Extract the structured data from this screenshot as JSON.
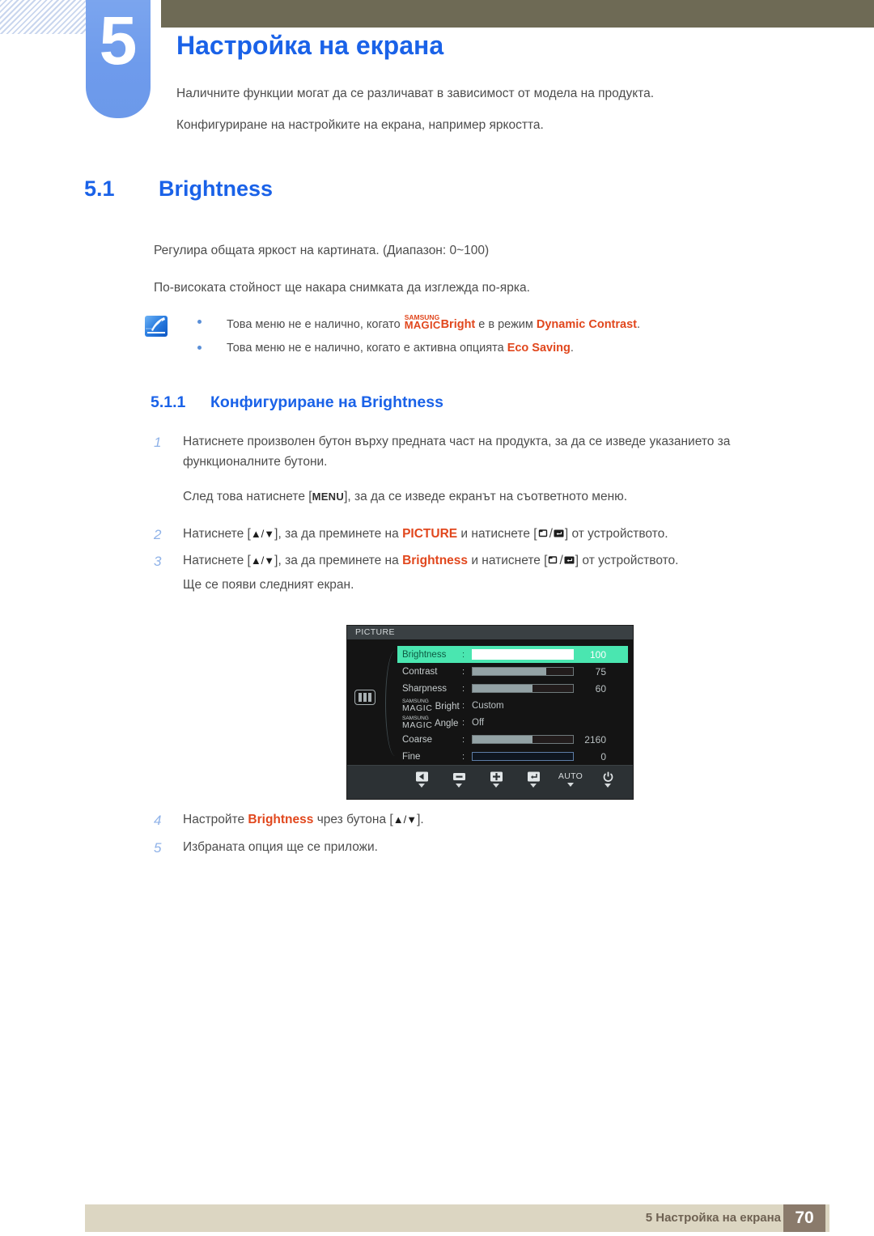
{
  "header": {
    "chapter_number": "5",
    "chapter_title": "Настройка на екрана",
    "intro_line_1": "Наличните функции могат да се различават в зависимост от модела на продукта.",
    "intro_line_2": "Конфигуриране на настройките на екрана, например яркостта."
  },
  "section": {
    "number": "5.1",
    "title": "Brightness",
    "paragraph_1": "Регулира общата яркост на картината. (Диапазон: 0~100)",
    "paragraph_2": "По-високата стойност ще накара снимката да изглежда по-ярка."
  },
  "note": {
    "icon": "note-pen-icon",
    "bullet_1": {
      "pre": "Това меню не е налично, когато ",
      "magic_sam": "SAMSUNG",
      "magic_mgc": "MAGIC",
      "brand_word": "Bright",
      "mid": " е в режим ",
      "highlight": "Dynamic Contrast",
      "post": "."
    },
    "bullet_2": {
      "pre": "Това меню не е налично, когато е активна опцията ",
      "highlight": "Eco Saving",
      "post": "."
    }
  },
  "subsection": {
    "number": "5.1.1",
    "title": "Конфигуриране на Brightness"
  },
  "steps": [
    {
      "num": "1",
      "text": "Натиснете произволен бутон върху предната част на продукта, за да се изведе указанието за функционалните бутони.",
      "followup_pre": "След това натиснете [",
      "followup_key": "MENU",
      "followup_post": "], за да се изведе екранът на съответното меню."
    },
    {
      "num": "2",
      "pre": "Натиснете [",
      "arrows": "▲/▼",
      "mid": "], за да преминете на ",
      "highlight": "PICTURE",
      "mid2": " и натиснете [",
      "btn_icons": "window-icon / enter-icon",
      "post": "] от устройството."
    },
    {
      "num": "3",
      "pre": "Натиснете [",
      "arrows": "▲/▼",
      "mid": "], за да преминете на ",
      "highlight": "Brightness",
      "mid2": " и натиснете [",
      "btn_icons": "window-icon / enter-icon",
      "post": "] от устройството.",
      "followup": "Ще се появи следният екран."
    },
    {
      "num": "4",
      "pre": "Настройте ",
      "highlight": "Brightness",
      "mid": " чрез бутона [",
      "arrows": "▲/▼",
      "post": "]."
    },
    {
      "num": "5",
      "text": "Избраната опция ще се приложи."
    }
  ],
  "osd": {
    "title": "PICTURE",
    "category_icon": "picture-bars-icon",
    "rows": [
      {
        "label": "Brightness",
        "colon": ":",
        "type": "slider",
        "fill": 100,
        "value": "100",
        "highlighted": true
      },
      {
        "label": "Contrast",
        "colon": ":",
        "type": "slider",
        "fill": 73,
        "value": "75",
        "highlighted": false
      },
      {
        "label": "Sharpness",
        "colon": ":",
        "type": "slider",
        "fill": 60,
        "value": "60",
        "highlighted": false
      },
      {
        "label": "Bright",
        "colon": ":",
        "type": "text",
        "magic_sam": "SAMSUNG",
        "magic_mgc": "MAGIC",
        "value": "Custom",
        "highlighted": false
      },
      {
        "label": "Angle",
        "colon": ":",
        "type": "text",
        "magic_sam": "SAMSUNG",
        "magic_mgc": "MAGIC",
        "value": "Off",
        "highlighted": false
      },
      {
        "label": "Coarse",
        "colon": ":",
        "type": "slider",
        "fill": 60,
        "value": "2160",
        "highlighted": false
      },
      {
        "label": "Fine",
        "colon": ":",
        "type": "slider-blue",
        "fill": 0,
        "value": "0",
        "highlighted": false
      }
    ],
    "buttons": [
      {
        "icon": "left-arrow-icon",
        "label": ""
      },
      {
        "icon": "minus-icon",
        "label": ""
      },
      {
        "icon": "plus-icon",
        "label": ""
      },
      {
        "icon": "enter-icon",
        "label": ""
      },
      {
        "icon": "",
        "label": "AUTO"
      },
      {
        "icon": "power-icon",
        "label": ""
      }
    ]
  },
  "footer": {
    "text": "5 Настройка на екрана",
    "page_number": "70"
  },
  "colors": {
    "accent_blue": "#1a62e8",
    "tab_blue": "#6e9bec",
    "olive": "#6e6a55",
    "orange": "#e1471d",
    "osd_highlight": "#4ae6b0",
    "footer_bg": "#dcd6c2",
    "page_box": "#8a7a6b"
  }
}
